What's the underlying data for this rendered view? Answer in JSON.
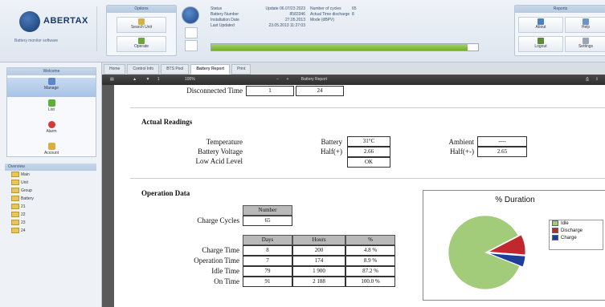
{
  "header": {
    "brand_name": "ABERTAX",
    "brand_tagline": "Battery monitor software",
    "group1_title": "Options",
    "btn_search": "Search Unit",
    "btn_operate": "Operate",
    "info_rows": [
      {
        "k": "Status",
        "v": "Update 06.07/23 2023",
        "k2": "Number of cycles",
        "v2": "65"
      },
      {
        "k": "Battery Number",
        "v": "8583346",
        "k2": "Actual Time discharge",
        "v2": "8"
      },
      {
        "k": "Installation Date",
        "v": "27.05.2013",
        "k2": "Mode (dBPV)",
        "v2": ""
      },
      {
        "k": "Last Updated",
        "v": "23.05.2013 11:27:03",
        "k2": "",
        "v2": ""
      }
    ],
    "progress": 0.96,
    "group2_title": "Reports",
    "btn_about": "About",
    "btn_help": "Help",
    "btn_logout": "Logout",
    "btn_settings": "Settings"
  },
  "sidebar": {
    "nav_title": "Welcome",
    "items": [
      {
        "label": "Manage",
        "color": "#5a87c8"
      },
      {
        "label": "List",
        "color": "#5fae3a"
      },
      {
        "label": "Alarm",
        "color": "#d23a3a"
      },
      {
        "label": "Account",
        "color": "#d8b040"
      }
    ],
    "tree_title": "Overview",
    "tree": [
      "Main",
      "Unit",
      "Group",
      "Battery",
      "21",
      "22",
      "23",
      "24"
    ]
  },
  "tabs": [
    "Home",
    "Control Info",
    "BTS Pool",
    "Battery Report",
    "Print"
  ],
  "viewer": {
    "zoom": "100%",
    "page": "1",
    "doc_title": "Battery Report"
  },
  "report": {
    "disconnected_label": "Disconnected Time",
    "disconnected_val1": "1",
    "disconnected_val2": "24",
    "readings_title": "Actual Readings",
    "temperature_label": "Temperature",
    "battery_voltage_label": "Battery Voltage",
    "low_acid_label": "Low Acid Level",
    "battery_label": "Battery",
    "half_label": "Half(+)",
    "half_label2": "Half(+-)",
    "ambient_label": "Ambient",
    "temp_val": "31°C",
    "half1_val": "2.66",
    "acid_val": "OK",
    "ambient_val": "----",
    "half2_val": "2.65",
    "operation_title": "Operation Data",
    "number_header": "Number",
    "charge_cycles_label": "Charge Cycles",
    "charge_cycles_val": "65",
    "col_days": "Days",
    "col_hours": "Hours",
    "col_pct": "%",
    "rows": [
      {
        "label": "Charge Time",
        "days": "8",
        "hours": "200",
        "pct": "4.8 %"
      },
      {
        "label": "Operation Time",
        "days": "7",
        "hours": "174",
        "pct": "8.9 %"
      },
      {
        "label": "Idle Time",
        "days": "79",
        "hours": "1 900",
        "pct": "87.2 %"
      },
      {
        "label": "On Time",
        "days": "91",
        "hours": "2 188",
        "pct": "100.0 %"
      }
    ]
  },
  "chart_data": {
    "type": "pie",
    "title": "% Duration",
    "categories": [
      "Idle",
      "Discharge",
      "Charge"
    ],
    "values": [
      87.2,
      8.9,
      4.8
    ],
    "colors": [
      "#a3cc7a",
      "#c0282d",
      "#1f3e9c"
    ],
    "legend": "right"
  }
}
